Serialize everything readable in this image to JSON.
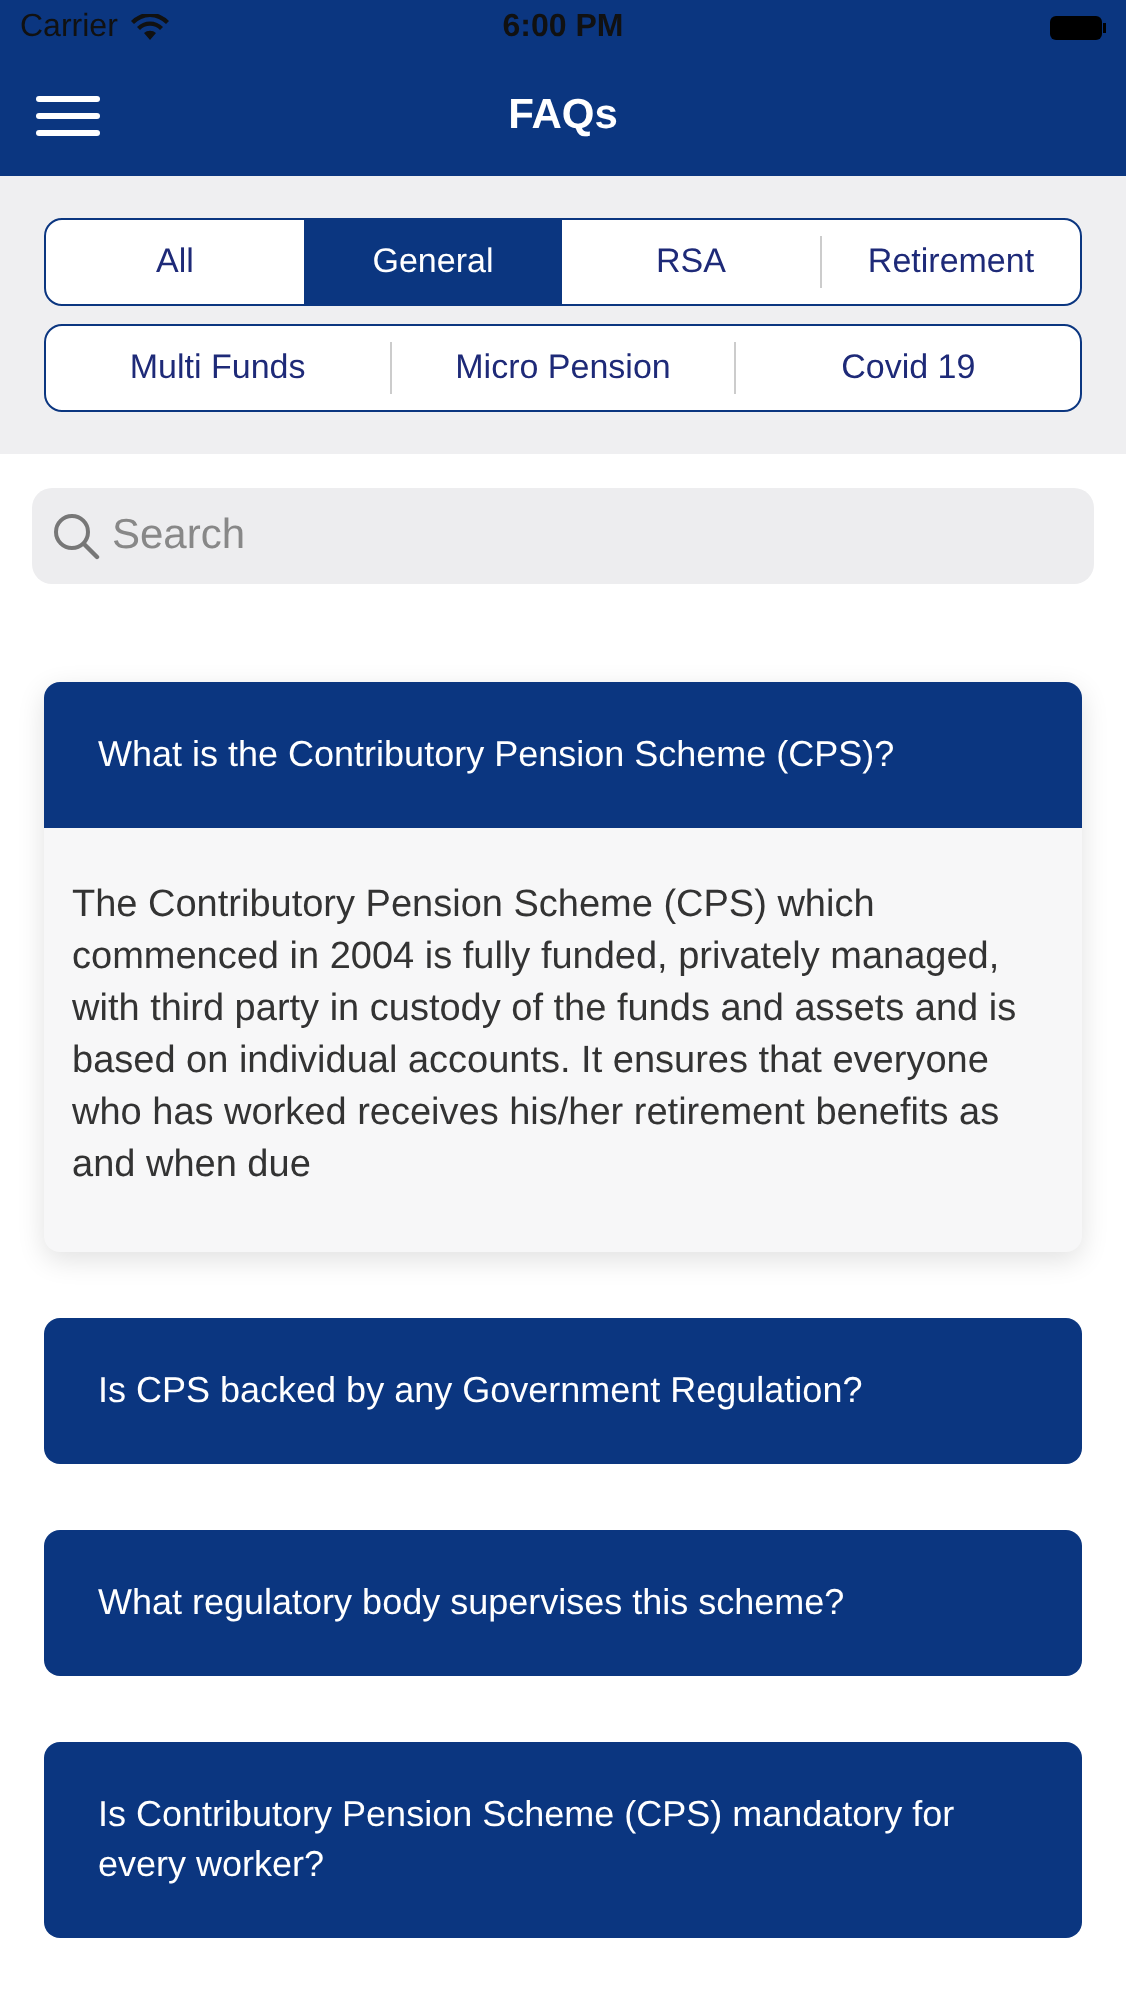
{
  "status_bar": {
    "carrier": "Carrier",
    "time": "6:00 PM"
  },
  "nav": {
    "title": "FAQs"
  },
  "tab_rows": [
    {
      "tabs": [
        {
          "label": "All",
          "selected": false
        },
        {
          "label": "General",
          "selected": true
        },
        {
          "label": "RSA",
          "selected": false
        },
        {
          "label": "Retirement",
          "selected": false
        }
      ]
    },
    {
      "tabs": [
        {
          "label": "Multi Funds",
          "selected": false
        },
        {
          "label": "Micro Pension",
          "selected": false
        },
        {
          "label": "Covid 19",
          "selected": false
        }
      ]
    }
  ],
  "search": {
    "placeholder": "Search"
  },
  "faqs": [
    {
      "question": "What is the Contributory Pension Scheme (CPS)?",
      "expanded": true,
      "answer": "The Contributory Pension Scheme (CPS) which commenced in 2004 is fully funded, privately managed, with third party in custody of the funds and assets and is based on individual accounts. It ensures that everyone who has worked receives his/her retirement benefits as and when due"
    },
    {
      "question": "Is CPS backed by any Government Regulation?",
      "expanded": false
    },
    {
      "question": "What regulatory body supervises this scheme?",
      "expanded": false
    },
    {
      "question": "Is Contributory Pension Scheme (CPS) mandatory for every worker?",
      "expanded": false
    }
  ]
}
